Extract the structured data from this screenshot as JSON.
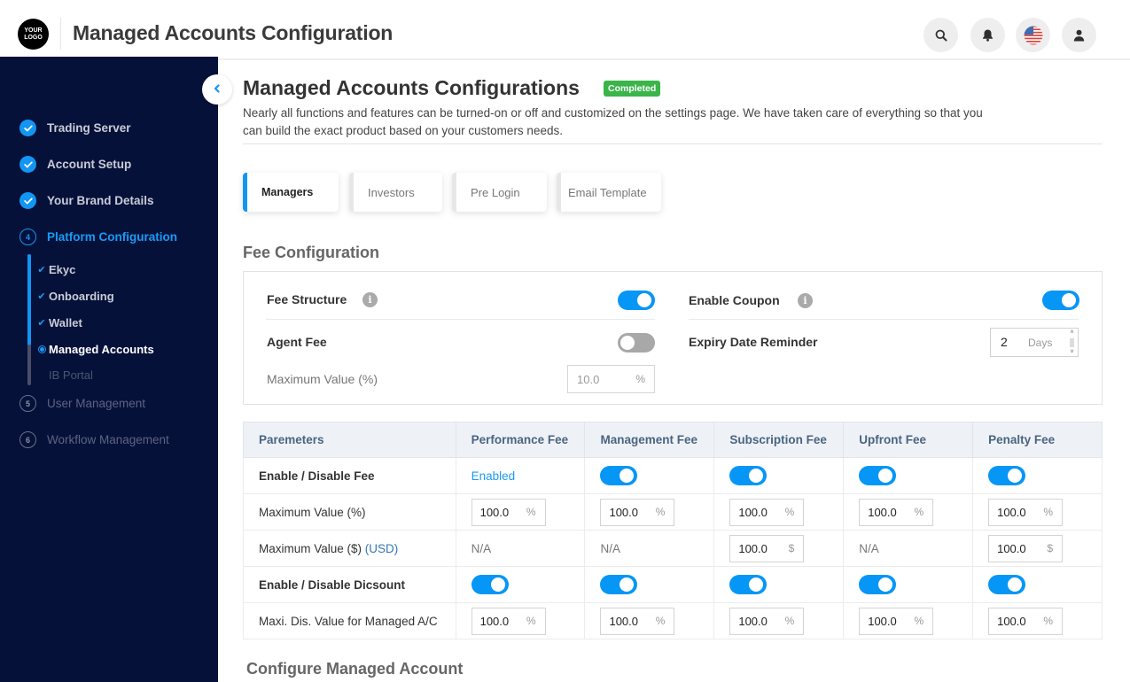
{
  "header": {
    "logo_text": "YOUR LOGO",
    "title": "Managed Accounts Configuration",
    "buttons": [
      {
        "name": "search",
        "icon": "search-icon"
      },
      {
        "name": "notifications",
        "icon": "bell-icon"
      },
      {
        "name": "language",
        "icon": "us-flag-icon"
      },
      {
        "name": "profile",
        "icon": "user-icon"
      }
    ]
  },
  "sidebar": {
    "collapse_icon": "chevron-left-icon",
    "steps": [
      {
        "label": "Trading Server",
        "status": "done"
      },
      {
        "label": "Account Setup",
        "status": "done"
      },
      {
        "label": "Your Brand Details",
        "status": "done"
      },
      {
        "number": "4",
        "label": "Platform Configuration",
        "status": "active"
      },
      {
        "number": "5",
        "label": "User Management",
        "status": "pending"
      },
      {
        "number": "6",
        "label": "Workflow Management",
        "status": "pending"
      }
    ],
    "substeps": [
      {
        "label": "Ekyc",
        "status": "done"
      },
      {
        "label": "Onboarding",
        "status": "done"
      },
      {
        "label": "Wallet",
        "status": "done"
      },
      {
        "label": "Managed Accounts",
        "status": "current"
      },
      {
        "label": "IB Portal",
        "status": "pending"
      }
    ]
  },
  "main": {
    "title": "Managed Accounts Configurations",
    "badge": "Completed",
    "description": "Nearly all functions and features can be turned-on or off and customized on the settings page. We have taken care of everything so that you can build the exact product based on your customers needs.",
    "tabs": [
      {
        "label": "Managers",
        "active": true
      },
      {
        "label": "Investors",
        "active": false
      },
      {
        "label": "Pre Login",
        "active": false
      },
      {
        "label": "Email Template",
        "active": false
      }
    ],
    "fee_config": {
      "title": "Fee Configuration",
      "fee_structure": {
        "label": "Fee Structure",
        "enabled": true
      },
      "agent_fee": {
        "label": "Agent Fee",
        "enabled": false
      },
      "max_value": {
        "label": "Maximum Value (%)",
        "value": "10.0",
        "unit": "%"
      },
      "enable_coupon": {
        "label": "Enable Coupon",
        "enabled": true
      },
      "expiry_reminder": {
        "label": "Expiry Date Reminder",
        "value": "2",
        "unit": "Days"
      }
    },
    "fee_table": {
      "headers": [
        "Paremeters",
        "Performance Fee",
        "Management Fee",
        "Subscription Fee",
        "Upfront Fee",
        "Penalty Fee"
      ],
      "rows": [
        {
          "label": "Enable / Disable Fee",
          "strong": true,
          "cells": [
            {
              "type": "text",
              "value": "Enabled"
            },
            {
              "type": "toggle",
              "on": true
            },
            {
              "type": "toggle",
              "on": true
            },
            {
              "type": "toggle",
              "on": true
            },
            {
              "type": "toggle",
              "on": true
            }
          ]
        },
        {
          "label": "Maximum Value (%)",
          "strong": false,
          "cells": [
            {
              "type": "input",
              "value": "100.0",
              "unit": "%"
            },
            {
              "type": "input",
              "value": "100.0",
              "unit": "%"
            },
            {
              "type": "input",
              "value": "100.0",
              "unit": "%"
            },
            {
              "type": "input",
              "value": "100.0",
              "unit": "%"
            },
            {
              "type": "input",
              "value": "100.0",
              "unit": "%"
            }
          ]
        },
        {
          "label": "Maximum Value ($)",
          "label_suffix": "(USD)",
          "strong": false,
          "cells": [
            {
              "type": "na",
              "value": "N/A"
            },
            {
              "type": "na",
              "value": "N/A"
            },
            {
              "type": "input",
              "value": "100.0",
              "unit": "$"
            },
            {
              "type": "na",
              "value": "N/A"
            },
            {
              "type": "input",
              "value": "100.0",
              "unit": "$"
            }
          ]
        },
        {
          "label": "Enable / Disable Dicsount",
          "strong": true,
          "cells": [
            {
              "type": "toggle",
              "on": true
            },
            {
              "type": "toggle",
              "on": true
            },
            {
              "type": "toggle",
              "on": true
            },
            {
              "type": "toggle",
              "on": true
            },
            {
              "type": "toggle",
              "on": true
            }
          ]
        },
        {
          "label": "Maxi. Dis. Value for Managed A/C",
          "strong": false,
          "cells": [
            {
              "type": "input",
              "value": "100.0",
              "unit": "%"
            },
            {
              "type": "input",
              "value": "100.0",
              "unit": "%"
            },
            {
              "type": "input",
              "value": "100.0",
              "unit": "%"
            },
            {
              "type": "input",
              "value": "100.0",
              "unit": "%"
            },
            {
              "type": "input",
              "value": "100.0",
              "unit": "%"
            }
          ]
        }
      ]
    },
    "next_section_title": "Configure Managed Account"
  },
  "colors": {
    "sidebar_bg": "#06113a",
    "accent": "#0696f6",
    "badge_green": "#3ab54a",
    "toggle_off": "#a8a8a8"
  }
}
